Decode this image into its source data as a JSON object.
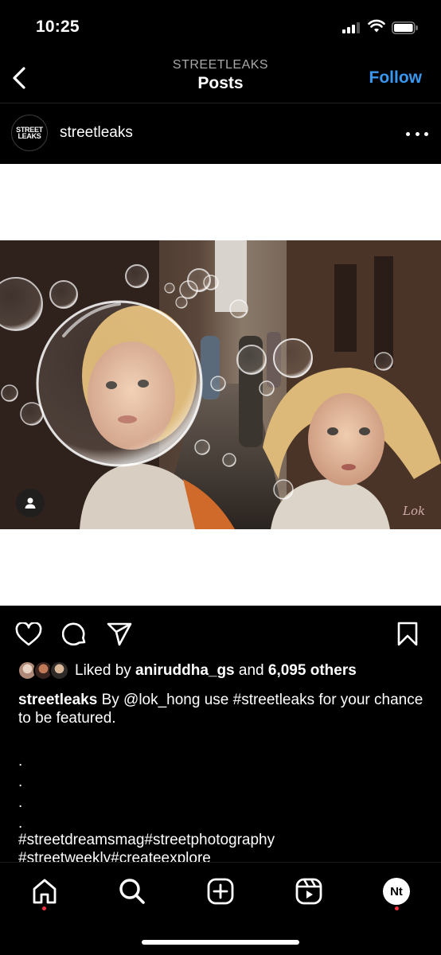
{
  "status_bar": {
    "time": "10:25"
  },
  "header": {
    "subtitle": "STREETLEAKS",
    "title": "Posts",
    "follow_label": "Follow"
  },
  "author": {
    "avatar_line1": "STREET",
    "avatar_line2": "LEAKS",
    "username": "streetleaks"
  },
  "post": {
    "photo_icon": "person-tag-icon",
    "signature": "Lok"
  },
  "actions": [
    "heart-icon",
    "comment-icon",
    "share-icon",
    "bookmark-icon"
  ],
  "likes": {
    "prefix": "Liked by ",
    "user": "aniruddha_gs",
    "middle": " and ",
    "count": "6,095 others"
  },
  "caption": {
    "username": "streetleaks",
    "text": " By @lok_hong use #streetleaks for your chance to be featured.",
    "dots": [
      ".",
      ".",
      ".",
      "."
    ],
    "hashtags_line1": "#streetdreamsmag#streetphotography",
    "hashtags_line2": "#streetweekly#createexplore"
  },
  "tab_bar": {
    "items": [
      "home-icon",
      "search-icon",
      "create-icon",
      "reels-icon",
      "profile-icon"
    ],
    "profile_initials": "Nt"
  },
  "colors": {
    "accent": "#3897f0",
    "notification": "#ff3040",
    "background": "#000000"
  }
}
